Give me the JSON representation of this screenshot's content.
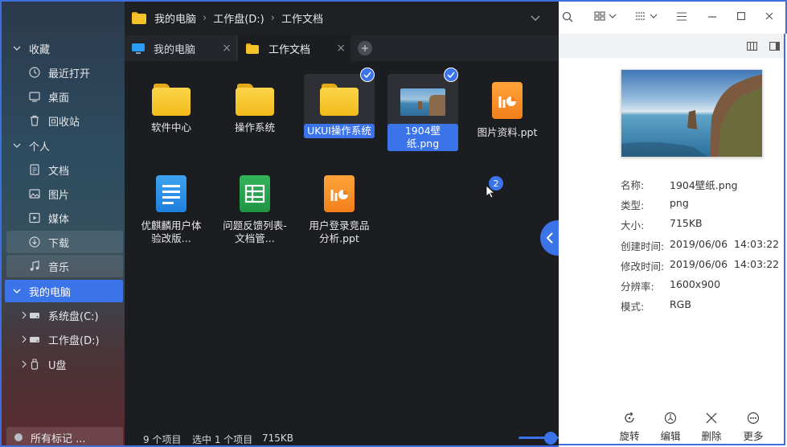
{
  "toolbar": {
    "breadcrumb": [
      "我的电脑",
      "工作盘(D:)",
      "工作文档"
    ]
  },
  "tabs": [
    {
      "label": "我的电脑"
    },
    {
      "label": "工作文档"
    }
  ],
  "sidebar": {
    "groups": [
      {
        "label": "收藏"
      },
      {
        "label": "个人"
      },
      {
        "label": "我的电脑"
      }
    ],
    "items": [
      {
        "label": "最近打开",
        "icon": "clock-icon"
      },
      {
        "label": "桌面",
        "icon": "desktop-icon"
      },
      {
        "label": "回收站",
        "icon": "trash-icon"
      },
      {
        "label": "文档",
        "icon": "document-icon"
      },
      {
        "label": "图片",
        "icon": "image-icon"
      },
      {
        "label": "媒体",
        "icon": "media-icon"
      },
      {
        "label": "下载",
        "icon": "download-icon"
      },
      {
        "label": "音乐",
        "icon": "music-icon"
      },
      {
        "label": "系统盘(C:)",
        "icon": "drive-icon"
      },
      {
        "label": "工作盘(D:)",
        "icon": "drive-icon"
      },
      {
        "label": "U盘",
        "icon": "usb-icon"
      }
    ],
    "tags_label": "所有标记 ..."
  },
  "files": [
    {
      "name": "软件中心",
      "type": "folder"
    },
    {
      "name": "操作系统",
      "type": "folder"
    },
    {
      "name": "UKUI操作系统",
      "type": "folder",
      "selected": true
    },
    {
      "name": "1904壁纸.png",
      "type": "image",
      "selected": true
    },
    {
      "name": "图片资料.ppt",
      "type": "ppt"
    },
    {
      "name": "优麒麟用户体验改版...",
      "type": "doc"
    },
    {
      "name": "问题反馈列表-文档管...",
      "type": "sheet"
    },
    {
      "name": "用户登录竞品分析.ppt",
      "type": "ppt"
    }
  ],
  "drag_badge": "2",
  "status": {
    "count": "9 个项目",
    "selected": "选中 1 个项目",
    "size": "715KB",
    "zoom_level": 0.5
  },
  "details": {
    "rows": [
      {
        "key": "名称:",
        "value": "1904壁纸.png"
      },
      {
        "key": "类型:",
        "value": "png"
      },
      {
        "key": "大小:",
        "value": "715KB"
      },
      {
        "key": "创建时间:",
        "value": "2019/06/06  14:03:22"
      },
      {
        "key": "修改时间:",
        "value": "2019/06/06  14:03:22"
      },
      {
        "key": "分辨率:",
        "value": "1600x900"
      },
      {
        "key": "模式:",
        "value": "RGB"
      }
    ],
    "actions": [
      {
        "label": "旋转",
        "icon": "rotate-icon"
      },
      {
        "label": "编辑",
        "icon": "edit-icon"
      },
      {
        "label": "删除",
        "icon": "delete-icon"
      },
      {
        "label": "更多",
        "icon": "more-icon"
      }
    ]
  },
  "colors": {
    "accent": "#3d6fe0",
    "selection": "#3b73e8",
    "dark_bg": "#1c1d21",
    "folder": "#f5c12a"
  }
}
